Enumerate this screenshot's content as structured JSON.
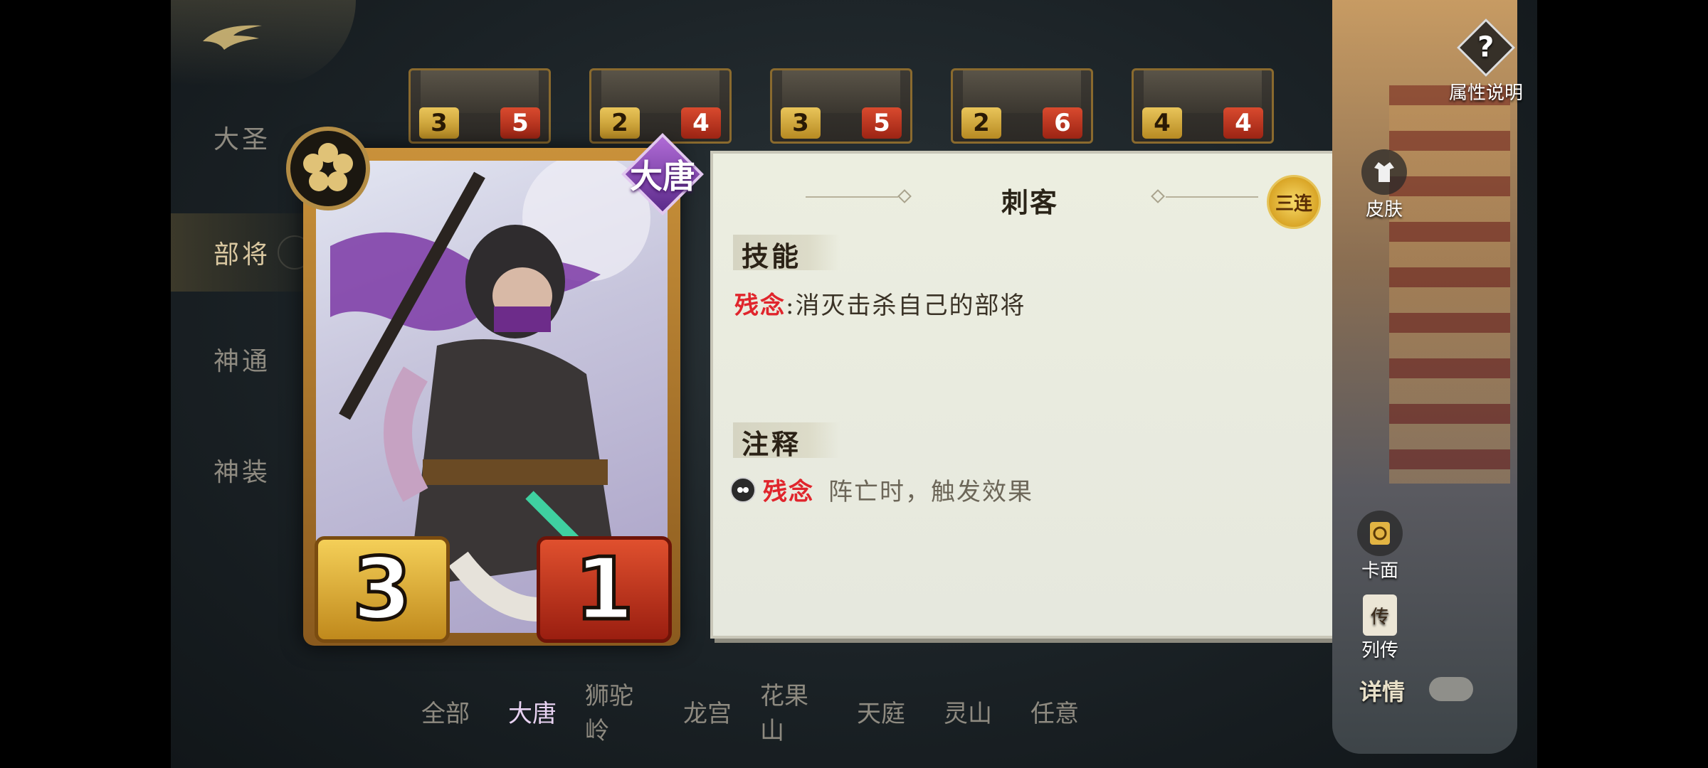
{
  "nav": {
    "items": [
      {
        "label": "大圣",
        "active": false
      },
      {
        "label": "部将",
        "active": true
      },
      {
        "label": "神通",
        "active": false
      },
      {
        "label": "神装",
        "active": false
      }
    ]
  },
  "mini_cards": [
    {
      "atk": "3",
      "hp": "5"
    },
    {
      "atk": "2",
      "hp": "4"
    },
    {
      "atk": "3",
      "hp": "5"
    },
    {
      "atk": "2",
      "hp": "6"
    },
    {
      "atk": "4",
      "hp": "4"
    }
  ],
  "card": {
    "faction": "大唐",
    "attack": "3",
    "health": "1",
    "faction_color": "#7a3aa8"
  },
  "panel": {
    "title": "刺客",
    "badge": "三连",
    "skill_heading": "技能",
    "skill_keyword": "残念",
    "skill_separator": ":",
    "skill_text": "消灭击杀自己的部将",
    "note_heading": "注释",
    "note_keyword": "残念",
    "note_text": "阵亡时，触发效果",
    "note_icon": "skull-icon"
  },
  "side": {
    "help_icon": "?",
    "help_label": "属性说明",
    "skin_label": "皮肤",
    "face_label": "卡面",
    "bio_icon_text": "传",
    "bio_label": "列传",
    "detail_label": "详情"
  },
  "filters": [
    {
      "label": "全部",
      "color": "#5a3a2a",
      "active": false
    },
    {
      "label": "大唐",
      "color": "#6a3a96",
      "active": true
    },
    {
      "label": "狮驼岭",
      "color": "#2e3a7a",
      "active": false
    },
    {
      "label": "龙宫",
      "color": "#2e4aa0",
      "active": false
    },
    {
      "label": "花果山",
      "color": "#8a2a2a",
      "active": false
    },
    {
      "label": "天庭",
      "color": "#8a3a7a",
      "active": false
    },
    {
      "label": "灵山",
      "color": "#8a7a1a",
      "active": false
    },
    {
      "label": "任意",
      "color": "#4a4a48",
      "active": false
    }
  ]
}
